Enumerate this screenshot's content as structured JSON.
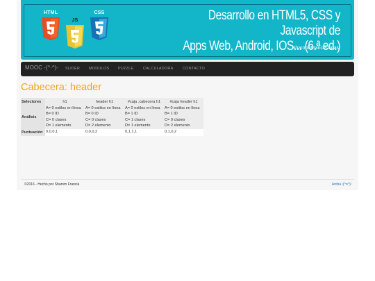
{
  "banner": {
    "title_line1": "Desarrollo en HTML5, CSS y Javascript de",
    "title_line2": "Apps Web, Android, IOS... (6.ª ed.)",
    "author": "Sharom Francia Arias",
    "logos": [
      {
        "label": "HTML",
        "glyph": "5",
        "color": "#e44d26",
        "icon": "html5-logo-icon"
      },
      {
        "label": "JS",
        "glyph": "JS",
        "color": "#f0db4f",
        "icon": "javascript-logo-icon"
      },
      {
        "label": "CSS",
        "glyph": "3",
        "color": "#1572b6",
        "icon": "css3-logo-icon"
      }
    ]
  },
  "navbar": {
    "brand": "MOOC -(^·^)-",
    "links": [
      "SLIDER",
      "MODULOS",
      "PUZZLE",
      "CALCULADORA",
      "CONTACTO"
    ]
  },
  "main": {
    "title": "Cabecera: header",
    "table": {
      "row_labels": {
        "selectors": "Selectores",
        "analysis": "Análisis",
        "score": "Puntuación"
      },
      "columns": [
        {
          "selector": "h1",
          "analysis": [
            "A= 0 estilos en línea",
            "B= 0 ID",
            "C= 0 clases",
            "D= 1 elemento"
          ],
          "score": "0,0,0,1"
        },
        {
          "selector": "header h1",
          "analysis": [
            "A= 0 estilos en línea",
            "B= 0 ID",
            "C= 0 clases",
            "D= 2 elemento"
          ],
          "score": "0,0,0,2"
        },
        {
          "selector": "#caja .cabecera h1",
          "analysis": [
            "A= 0 estilos en línea",
            "B= 1 ID",
            "C= 1 clases",
            "D= 1 elemento"
          ],
          "score": "0,1,1,1"
        },
        {
          "selector": "#caja header h1",
          "analysis": [
            "A= 0 estilos en línea",
            "B= 1 ID",
            "C= 0 clases",
            "D= 2 elemento"
          ],
          "score": "0,1,0,2"
        }
      ]
    }
  },
  "footer": {
    "copyright": "©2016 - Hecho por Sharom Francia",
    "back_to_top": "Arriba \\(^o^)/"
  },
  "colors": {
    "banner_bg": "#13b5c8",
    "navbar_bg": "#222222",
    "title_accent": "#f0a51b",
    "link": "#2a7bc4"
  }
}
